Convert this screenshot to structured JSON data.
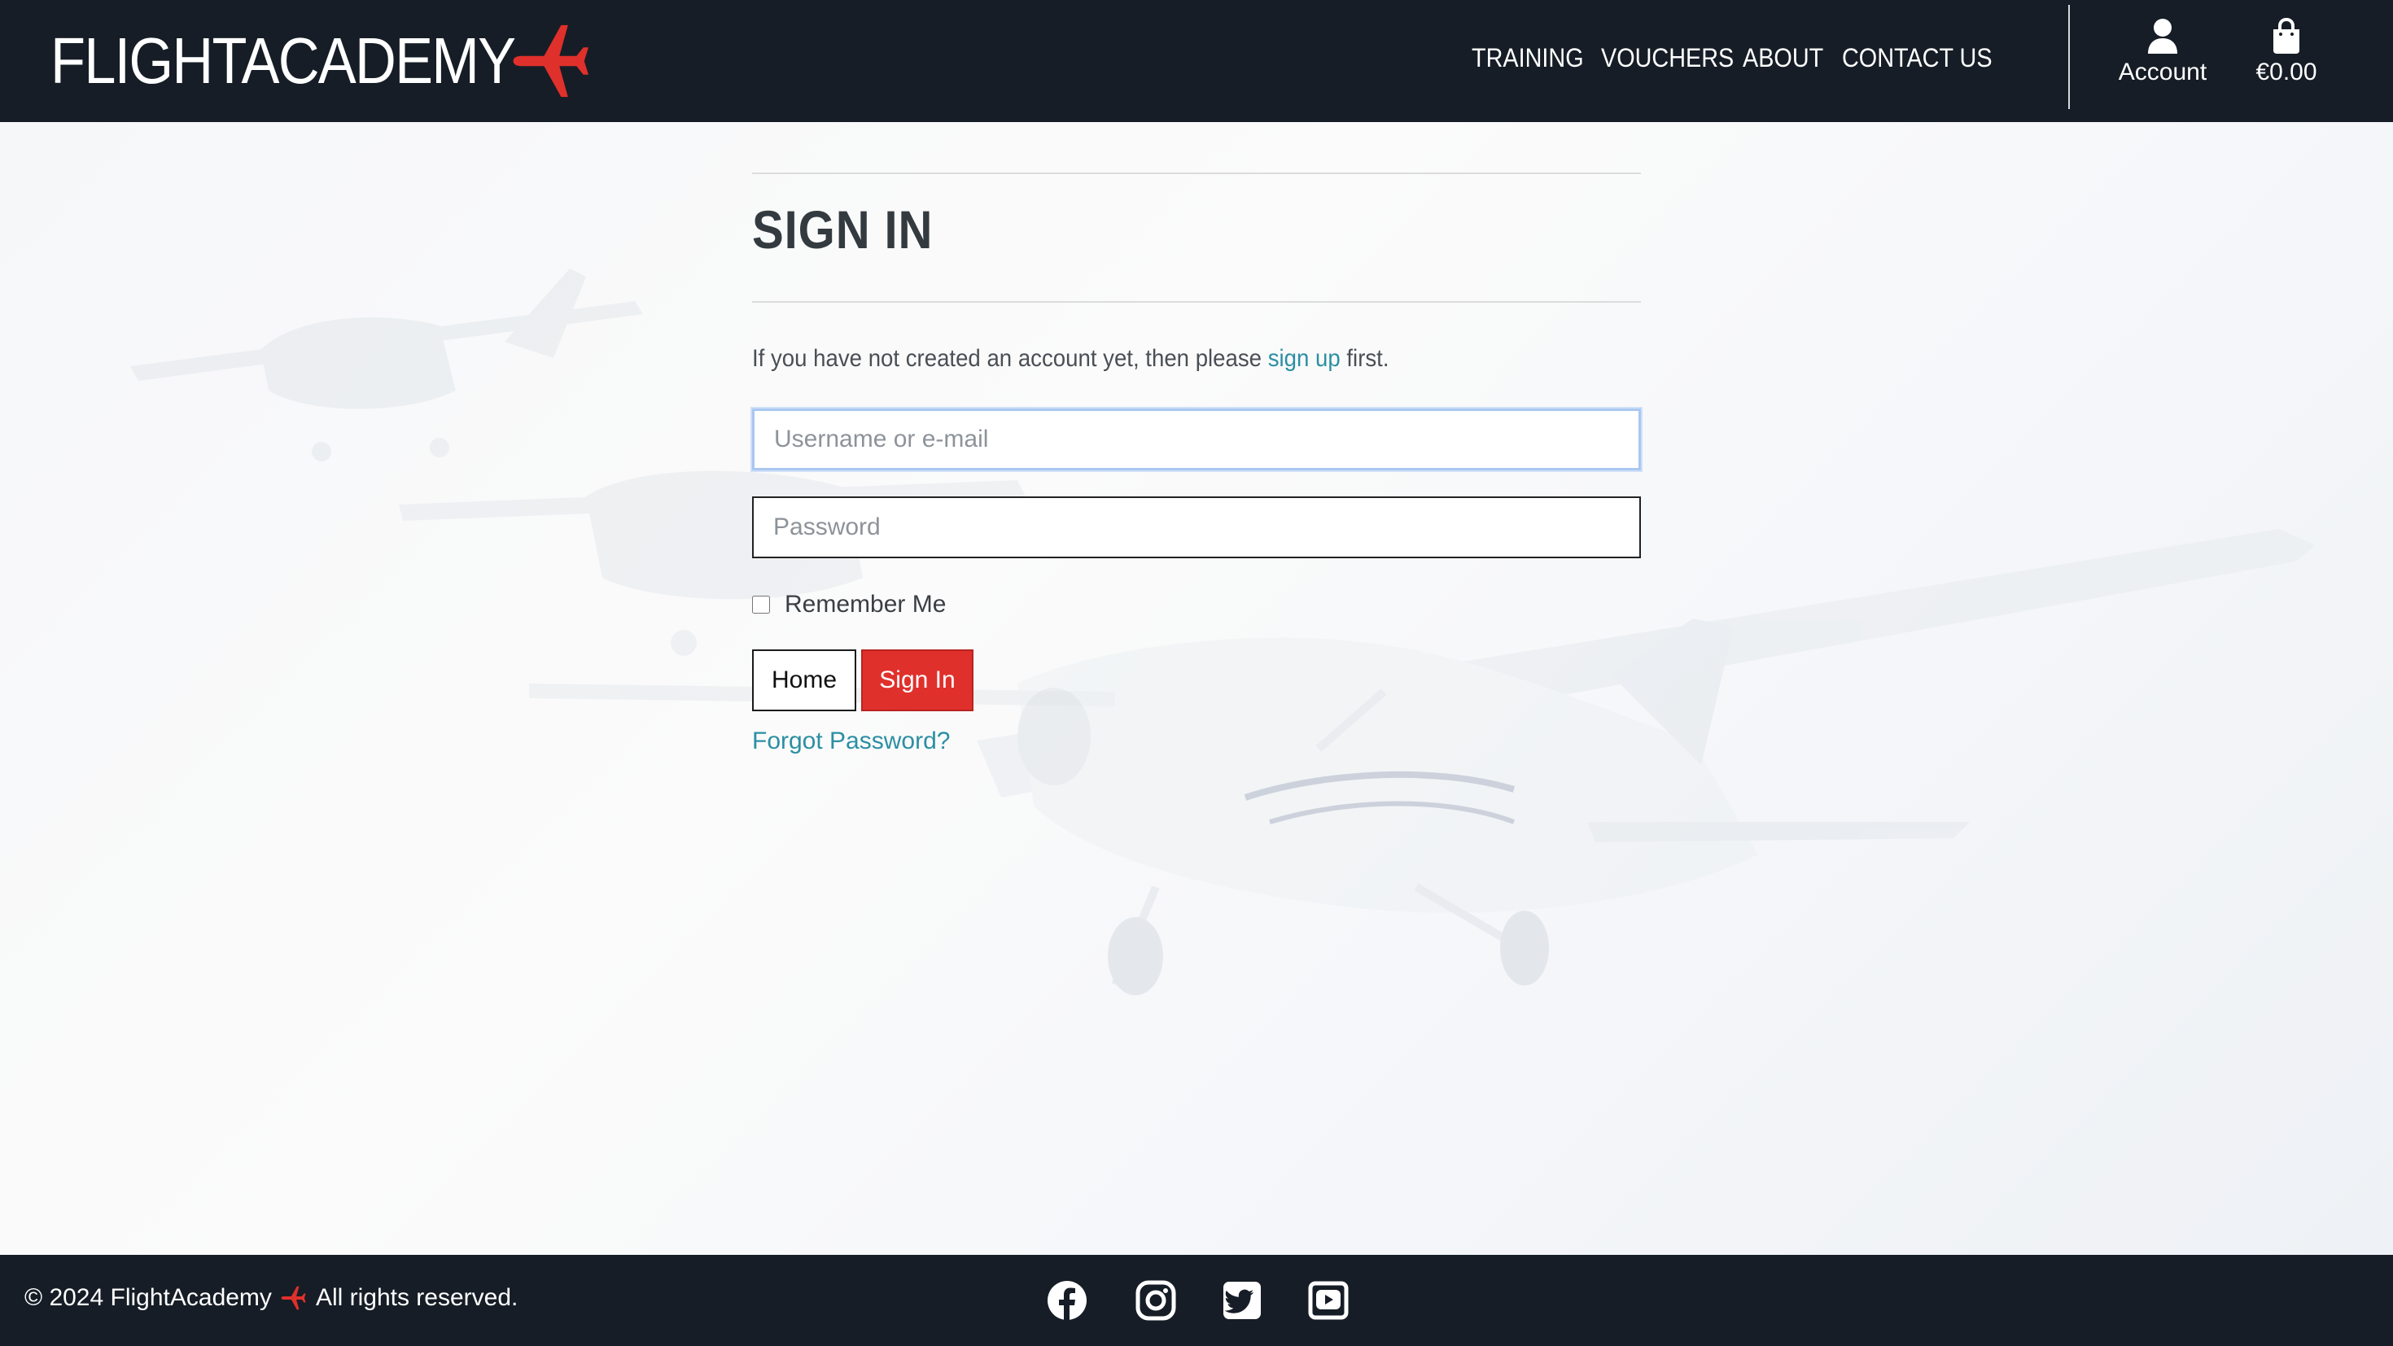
{
  "brand": {
    "name": "FLIGHTACADEMY",
    "accent_color": "#e0302b",
    "logo_icon": "airplane-icon"
  },
  "nav": {
    "items": [
      {
        "label": "TRAINING"
      },
      {
        "label": "VOUCHERS"
      },
      {
        "label": "ABOUT"
      },
      {
        "label": "CONTACT US"
      }
    ]
  },
  "header_actions": {
    "account_label": "Account",
    "account_icon": "user-icon",
    "cart_total": "€0.00",
    "cart_icon": "shopping-bag-icon"
  },
  "signin": {
    "title": "SIGN IN",
    "intro_before": "If you have not created an account yet, then please",
    "signup_link": "sign up",
    "intro_after": "first.",
    "username_placeholder": "Username or e-mail",
    "password_placeholder": "Password",
    "remember_label": "Remember Me",
    "remember_checked": false,
    "home_button": "Home",
    "signin_button": "Sign In",
    "forgot_link": "Forgot Password?"
  },
  "footer": {
    "copyright_prefix": "© 2024 FlightAcademy",
    "copyright_suffix": "All rights reserved.",
    "social_icons": [
      "facebook-icon",
      "instagram-icon",
      "twitter-icon",
      "youtube-icon"
    ]
  },
  "colors": {
    "header_bg": "#161d26",
    "link": "#2c8fa3",
    "signin_button": "#e0302b",
    "focus_ring": "#a9c7f0"
  }
}
